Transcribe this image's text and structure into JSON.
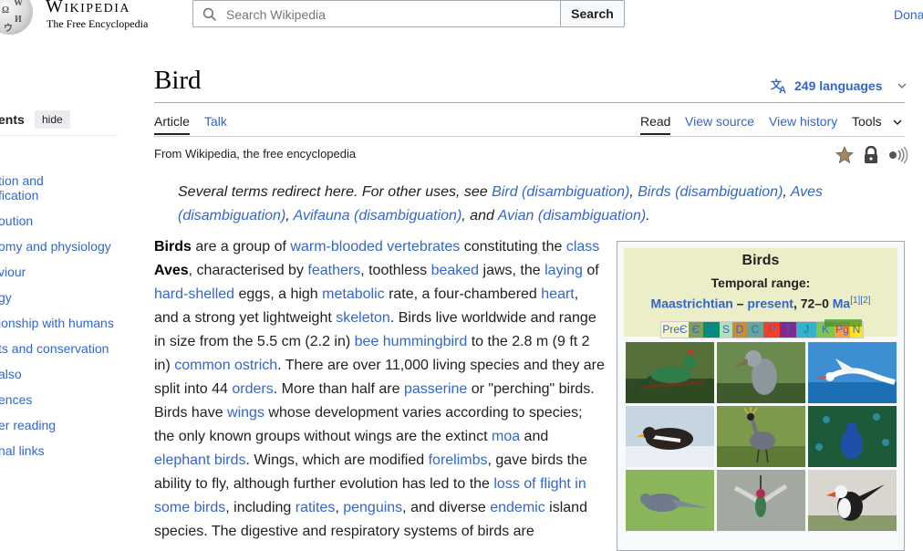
{
  "header": {
    "wordmark": "Wikipedia",
    "tagline": "The Free Encyclopedia",
    "search_placeholder": "Search Wikipedia",
    "search_button": "Search",
    "donate": "Dona"
  },
  "toc": {
    "title": "ents",
    "hide_label": "hide",
    "items": [
      "tion and",
      "fication",
      "oution",
      "omy and physiology",
      "viour",
      "gy",
      "ionship with humans",
      "ts and conservation",
      "also",
      "ences",
      "er reading",
      "nal links"
    ]
  },
  "page": {
    "title": "Bird",
    "languages": "249 languages",
    "tabs_left": [
      "Article",
      "Talk"
    ],
    "tabs_right": [
      "Read",
      "View source",
      "View history",
      "Tools"
    ],
    "from": "From Wikipedia, the free encyclopedia"
  },
  "hatnote": {
    "t1": "Several terms redirect here. For other uses, see ",
    "l1": "Bird (disambiguation)",
    "t2": ", ",
    "l2": "Birds (disambiguation)",
    "t3": ", ",
    "l3": "Aves (disambiguation)",
    "t4": ", ",
    "l4": "Avifauna (disambiguation)",
    "t5": ", and ",
    "l5": "Avian (disambiguation)",
    "t6": "."
  },
  "body": {
    "s01": "Birds",
    "s02": " are a group of ",
    "s03": "warm-blooded",
    "s04": " ",
    "s05": "vertebrates",
    "s06": " constituting the ",
    "s07": "class",
    "s08": " ",
    "s09": "Aves",
    "s10": ", characterised by ",
    "s11": "feathers",
    "s12": ", toothless ",
    "s13": "beaked",
    "s14": " jaws, the ",
    "s15": "laying",
    "s16": " of ",
    "s17": "hard-shelled",
    "s18": " eggs, a high ",
    "s19": "metabolic",
    "s20": " rate, a four-chambered ",
    "s21": "heart",
    "s22": ", and a strong yet lightweight ",
    "s23": "skeleton",
    "s24": ". Birds live worldwide and range in size from the 5.5 cm (2.2 in) ",
    "s25": "bee hummingbird",
    "s26": " to the 2.8 m (9 ft 2 in) ",
    "s27": "common ostrich",
    "s28": ". There are over 11,000 living species and they are split into 44 ",
    "s29": "orders",
    "s30": ". More than half are ",
    "s31": "passerine",
    "s32": " or \"perching\" birds. Birds have ",
    "s33": "wings",
    "s34": " whose development varies according to species; the only known groups without wings are the extinct ",
    "s35": "moa",
    "s36": " and ",
    "s37": "elephant birds",
    "s38": ". Wings, which are modified ",
    "s39": "forelimbs",
    "s40": ", gave birds the ability to fly, although further evolution has led to the ",
    "s41": "loss of flight in some birds",
    "s42": ", including ",
    "s43": "ratites",
    "s44": ", ",
    "s45": "penguins",
    "s46": ", and diverse ",
    "s47": "endemic",
    "s48": " island species. The digestive and respiratory systems of birds are"
  },
  "infobox": {
    "title": "Birds",
    "temporal": "Temporal range:",
    "range_start": "Maastrichtian",
    "range_dash": " – ",
    "range_end": "present",
    "range_value": ", 72–0 ",
    "range_unit": "Ma",
    "range_refs": "[1][2]",
    "timeline": [
      "PreЄ",
      "Є",
      "O",
      "S",
      "D",
      "C",
      "P",
      "T",
      "J",
      "K",
      "Pg",
      "N"
    ],
    "timeline_colors": [
      "#f7f2c8",
      "#7fa056",
      "#009270",
      "#b3e1b6",
      "#cb8c37",
      "#67a599",
      "#f04028",
      "#812b92",
      "#34b2c9",
      "#7fc64e",
      "#fd9a52",
      "#ffe619"
    ]
  },
  "colors": {
    "link": "#3366cc",
    "text": "#202122",
    "infobox_header": "#ebeec6"
  }
}
